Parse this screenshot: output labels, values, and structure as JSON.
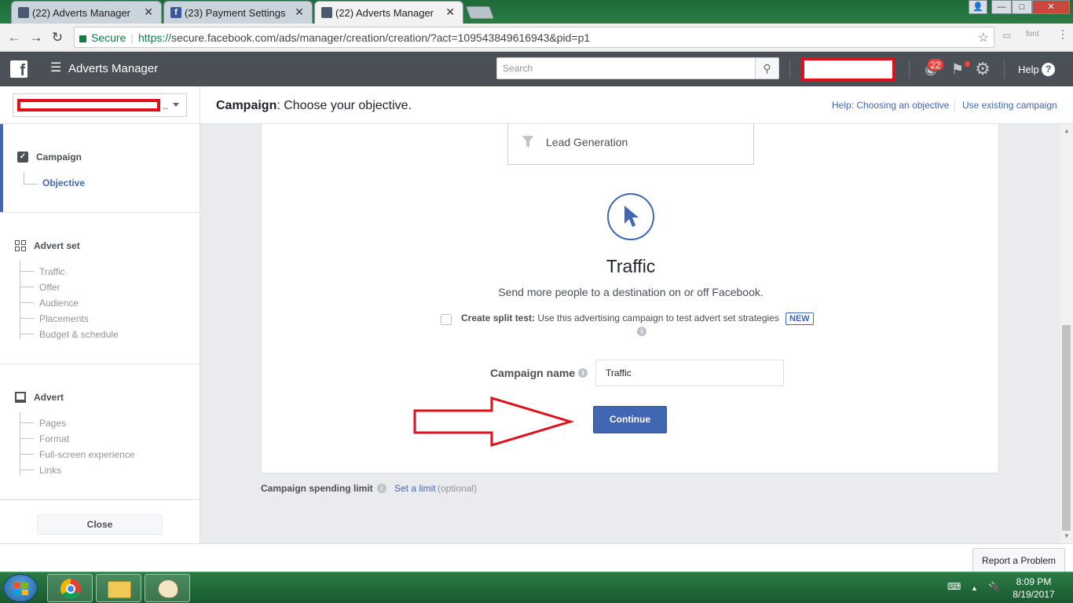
{
  "browser": {
    "tabs": [
      {
        "title": "(22) Adverts Manager",
        "favicon": "adverts-manager-icon",
        "active": false
      },
      {
        "title": "(23) Payment Settings",
        "favicon": "facebook-icon",
        "active": false
      },
      {
        "title": "(22) Adverts Manager",
        "favicon": "adverts-manager-icon",
        "active": true
      }
    ],
    "tab_close": "✕",
    "secure_label": "Secure",
    "url_prefix": "https://",
    "url_rest": "secure.facebook.com/ads/manager/creation/creation/?act=109543849616943&pid=p1",
    "ext_font_label": "font",
    "window_controls": [
      "—",
      "□",
      "✕"
    ]
  },
  "fb_header": {
    "logo": "f",
    "app_title": "Adverts Manager",
    "search_placeholder": "Search",
    "notifications_count": "22",
    "help_label": "Help"
  },
  "sidebar": {
    "account_dots": "..",
    "campaign": {
      "label": "Campaign",
      "sub": "Objective"
    },
    "advert_set": {
      "label": "Advert set",
      "items": [
        "Traffic",
        "Offer",
        "Audience",
        "Placements",
        "Budget & schedule"
      ]
    },
    "advert": {
      "label": "Advert",
      "items": [
        "Pages",
        "Format",
        "Full-screen experience",
        "Links"
      ]
    },
    "close_label": "Close"
  },
  "campaign_header": {
    "title_bold": "Campaign",
    "title_rest": ": Choose your objective.",
    "help_link": "Help: Choosing an objective",
    "existing_link": "Use existing campaign"
  },
  "objective": {
    "lead_generation": "Lead Generation",
    "traffic_title": "Traffic",
    "traffic_desc": "Send more people to a destination on or off Facebook.",
    "split_test_bold": "Create split test:",
    "split_test_text": " Use this advertising campaign to test advert set strategies",
    "new_badge": "NEW",
    "campaign_name_label": "Campaign name",
    "campaign_name_value": "Traffic",
    "continue_label": "Continue"
  },
  "spending": {
    "label": "Campaign spending limit",
    "link": "Set a limit",
    "optional": "(optional)"
  },
  "footer": {
    "report_label": "Report a Problem"
  },
  "taskbar": {
    "time": "8:09 PM",
    "date": "8/19/2017"
  },
  "colors": {
    "fb_blue": "#4267b2",
    "header_gray": "#4b4f56",
    "annotation_red": "#e0101a"
  }
}
